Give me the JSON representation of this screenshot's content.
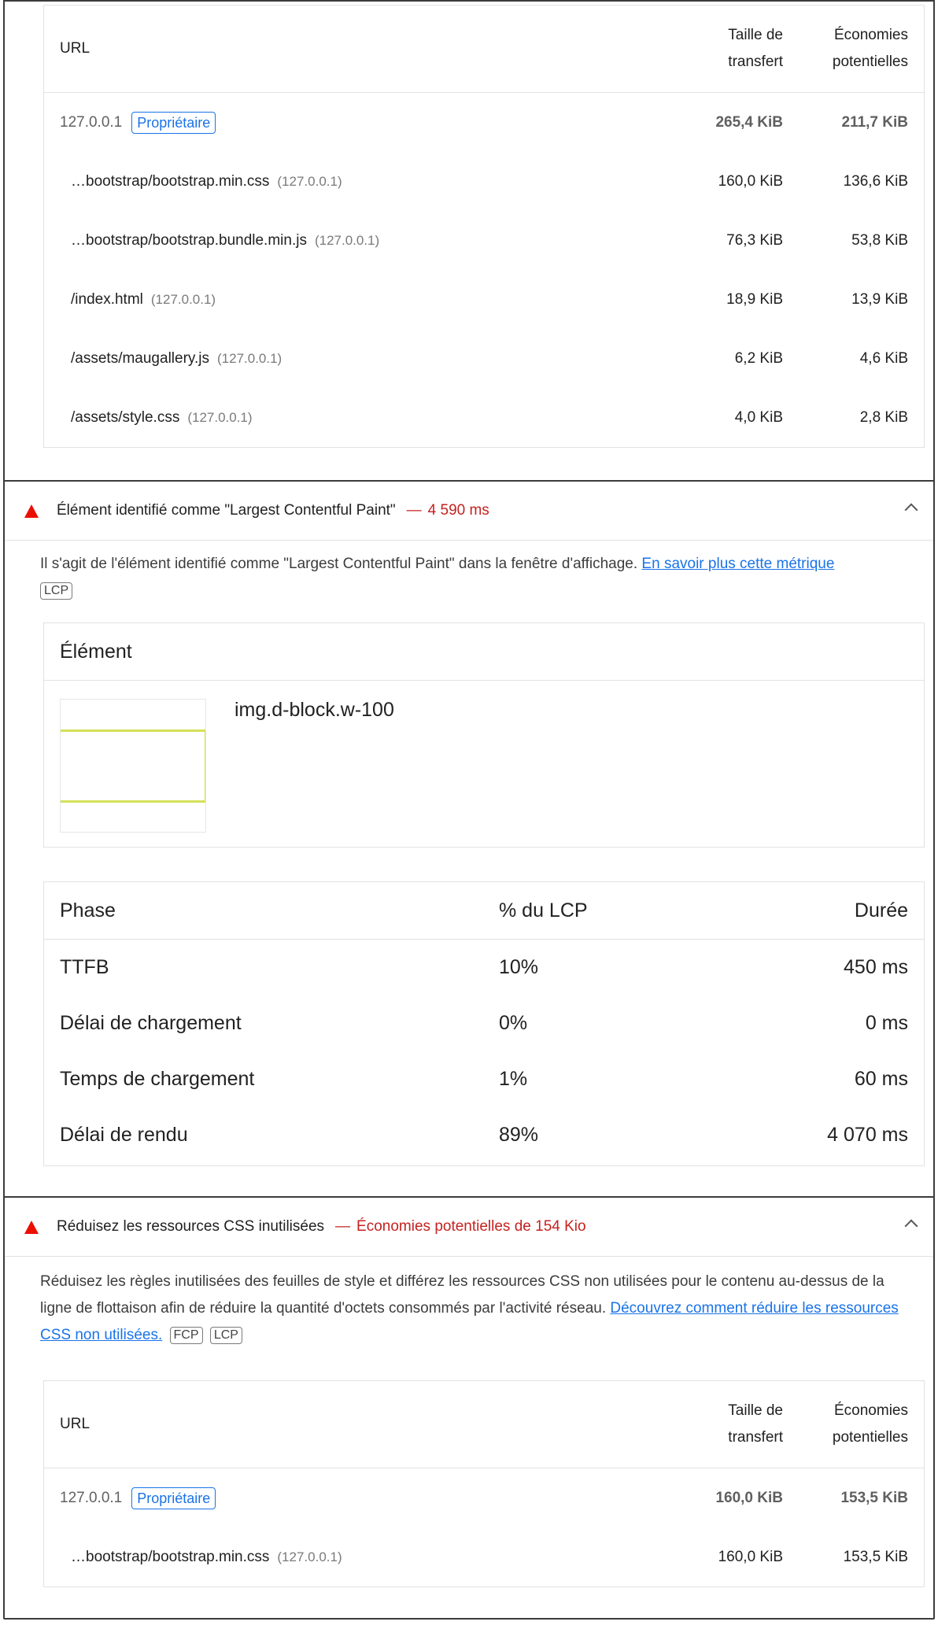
{
  "table1": {
    "col_url": "URL",
    "col_size_l1": "Taille de",
    "col_size_l2": "transfert",
    "col_save_l1": "Économies",
    "col_save_l2": "potentielles",
    "group": {
      "host": "127.0.0.1",
      "badge": "Propriétaire",
      "size": "265,4 KiB",
      "save": "211,7 KiB"
    },
    "rows": [
      {
        "url": "…bootstrap/bootstrap.min.css",
        "host": "(127.0.0.1)",
        "size": "160,0 KiB",
        "save": "136,6 KiB"
      },
      {
        "url": "…bootstrap/bootstrap.bundle.min.js",
        "host": "(127.0.0.1)",
        "size": "76,3 KiB",
        "save": "53,8 KiB"
      },
      {
        "url": "/index.html",
        "host": "(127.0.0.1)",
        "size": "18,9 KiB",
        "save": "13,9 KiB"
      },
      {
        "url": "/assets/maugallery.js",
        "host": "(127.0.0.1)",
        "size": "6,2 KiB",
        "save": "4,6 KiB"
      },
      {
        "url": "/assets/style.css",
        "host": "(127.0.0.1)",
        "size": "4,0 KiB",
        "save": "2,8 KiB"
      }
    ]
  },
  "lcp": {
    "title": "Élément identifié comme \"Largest Contentful Paint\"",
    "sep": "—",
    "value": "4 590 ms",
    "desc": "Il s'agit de l'élément identifié comme \"Largest Contentful Paint\" dans la fenêtre d'affichage.",
    "link": "En savoir plus cette métrique",
    "chip": "LCP",
    "element_header": "Élément",
    "selector": "img.d-block.w-100",
    "phase_head": {
      "phase": "Phase",
      "pct": "% du LCP",
      "dur": "Durée"
    },
    "phases": [
      {
        "phase": "TTFB",
        "pct": "10%",
        "dur": "450 ms"
      },
      {
        "phase": "Délai de chargement",
        "pct": "0%",
        "dur": "0 ms"
      },
      {
        "phase": "Temps de chargement",
        "pct": "1%",
        "dur": "60 ms"
      },
      {
        "phase": "Délai de rendu",
        "pct": "89%",
        "dur": "4 070 ms"
      }
    ]
  },
  "css": {
    "title": "Réduisez les ressources CSS inutilisées",
    "sep": "—",
    "value": "Économies potentielles de 154 Kio",
    "desc": "Réduisez les règles inutilisées des feuilles de style et différez les ressources CSS non utilisées pour le contenu au-dessus de la ligne de flottaison afin de réduire la quantité d'octets consommés par l'activité réseau.",
    "link": "Découvrez comment réduire les ressources CSS non utilisées.",
    "chip1": "FCP",
    "chip2": "LCP",
    "col_url": "URL",
    "col_size_l1": "Taille de",
    "col_size_l2": "transfert",
    "col_save_l1": "Économies",
    "col_save_l2": "potentielles",
    "group": {
      "host": "127.0.0.1",
      "badge": "Propriétaire",
      "size": "160,0 KiB",
      "save": "153,5 KiB"
    },
    "rows": [
      {
        "url": "…bootstrap/bootstrap.min.css",
        "host": "(127.0.0.1)",
        "size": "160,0 KiB",
        "save": "153,5 KiB"
      }
    ]
  },
  "colors": {
    "warn": "#eb0f00",
    "link": "#1a73e8",
    "thumb_line": "#d4e157"
  }
}
